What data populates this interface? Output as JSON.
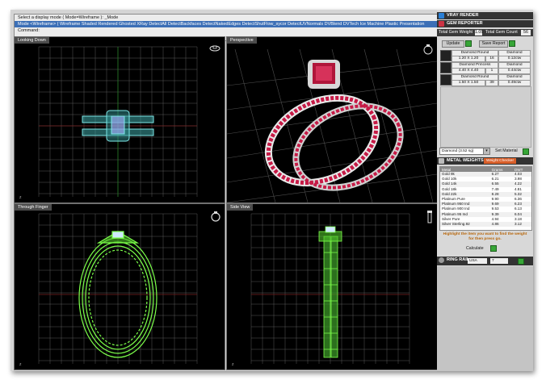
{
  "command": {
    "lines": [
      "Select a display mode ( Mode=Wireframe ): _Mode",
      "Mode <Wireframe> ( Wireframe  Shaded  Rendered  Ghosted  XRay  DetectAll  DetectBackfaces  DetectNakedEdges  DetectShutFlow_sycor  DetectUVNormals  DVBlend  DVTech  Ice  Machine  Plastic  Presentation",
      "Command:"
    ]
  },
  "viewports": [
    {
      "label": "Looking Down"
    },
    {
      "label": "Perspective"
    },
    {
      "label": "Through Finger"
    },
    {
      "label": "Side View"
    }
  ],
  "panel": {
    "vray_render": "VRAY RENDER",
    "gem_reporter": "GEM REPORTER",
    "total_gem_weight_label": "Total Gem Weight",
    "total_gem_weight_value": "1.05",
    "total_gem_count_label": "Total Gem Count",
    "total_gem_count_value": "56",
    "update_label": "Update",
    "save_report_label": "Save Report",
    "gems": [
      {
        "name": "Diamond Round",
        "type": "Diamond",
        "size": "1.20 X 1.20",
        "count": "16",
        "weight": "0.12ctw"
      },
      {
        "name": "Diamond Princess",
        "type": "Diamond",
        "size": "4.40 X 4.40",
        "count": "1",
        "weight": "0.44ctw"
      },
      {
        "name": "Diamond Round",
        "type": "Diamond",
        "size": "1.50 X 1.50",
        "count": "39",
        "weight": "0.49ctw"
      }
    ],
    "material_select": "Diamond  (3.52 sg)",
    "set_material_label": "Set Material",
    "metal_weights": "METAL WEIGHTS",
    "metal_sub": "Weight Checker",
    "metal_columns": [
      "Metal",
      "Grams",
      "DWT"
    ],
    "metals": [
      [
        "Gold 9k",
        "6.27",
        "4.03"
      ],
      [
        "Gold 10k",
        "6.21",
        "3.98"
      ],
      [
        "Gold 14k",
        "6.55",
        "4.22"
      ],
      [
        "Gold 18k",
        "7.49",
        "4.81"
      ],
      [
        "Gold 22k",
        "8.28",
        "5.32"
      ],
      [
        "Platinum Pure",
        "9.90",
        "6.36"
      ],
      [
        "Platinum 950 Ind",
        "9.69",
        "6.23"
      ],
      [
        "Platinum 900 Ind",
        "9.53",
        "6.13"
      ],
      [
        "Platinum 95 Ind",
        "9.39",
        "6.04"
      ],
      [
        "Silver Pure",
        "4.94",
        "3.18"
      ],
      [
        "Silver Sterling.92",
        "4.86",
        "3.12"
      ]
    ],
    "highlight_note": "Highlight the item you want to find the weight for then press go.",
    "calculate_label": "Calculate",
    "ring_rail": "RING RAIL",
    "ring_size_system": "USA",
    "ring_size": "7"
  },
  "colors": {
    "grid": "#5f5f5f",
    "wire_cyan": "#7ee8e8",
    "wire_green": "#7cff4a",
    "ruby": "#b0163a",
    "accent_green": "#37a637"
  }
}
